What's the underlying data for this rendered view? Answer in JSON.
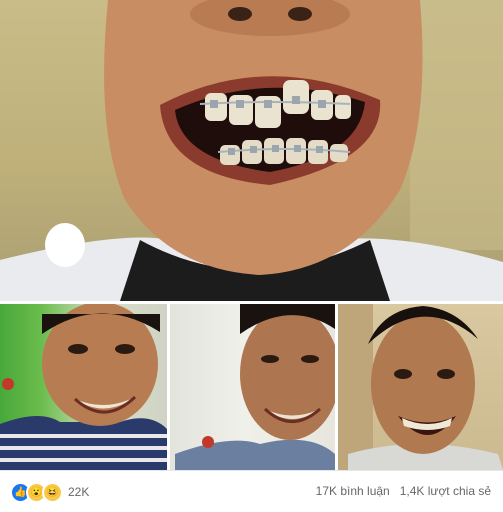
{
  "post": {
    "photos": [
      {
        "subject": "close-up-braces-smile"
      },
      {
        "subject": "smile-photo-1"
      },
      {
        "subject": "smile-photo-2"
      },
      {
        "subject": "smile-photo-3"
      }
    ],
    "reactions": {
      "icons": [
        "like-icon",
        "wow-icon",
        "haha-icon"
      ],
      "count": "22K"
    },
    "stats": {
      "comments": "17K bình luận",
      "shares": "1,4K lượt chia sẻ"
    }
  }
}
